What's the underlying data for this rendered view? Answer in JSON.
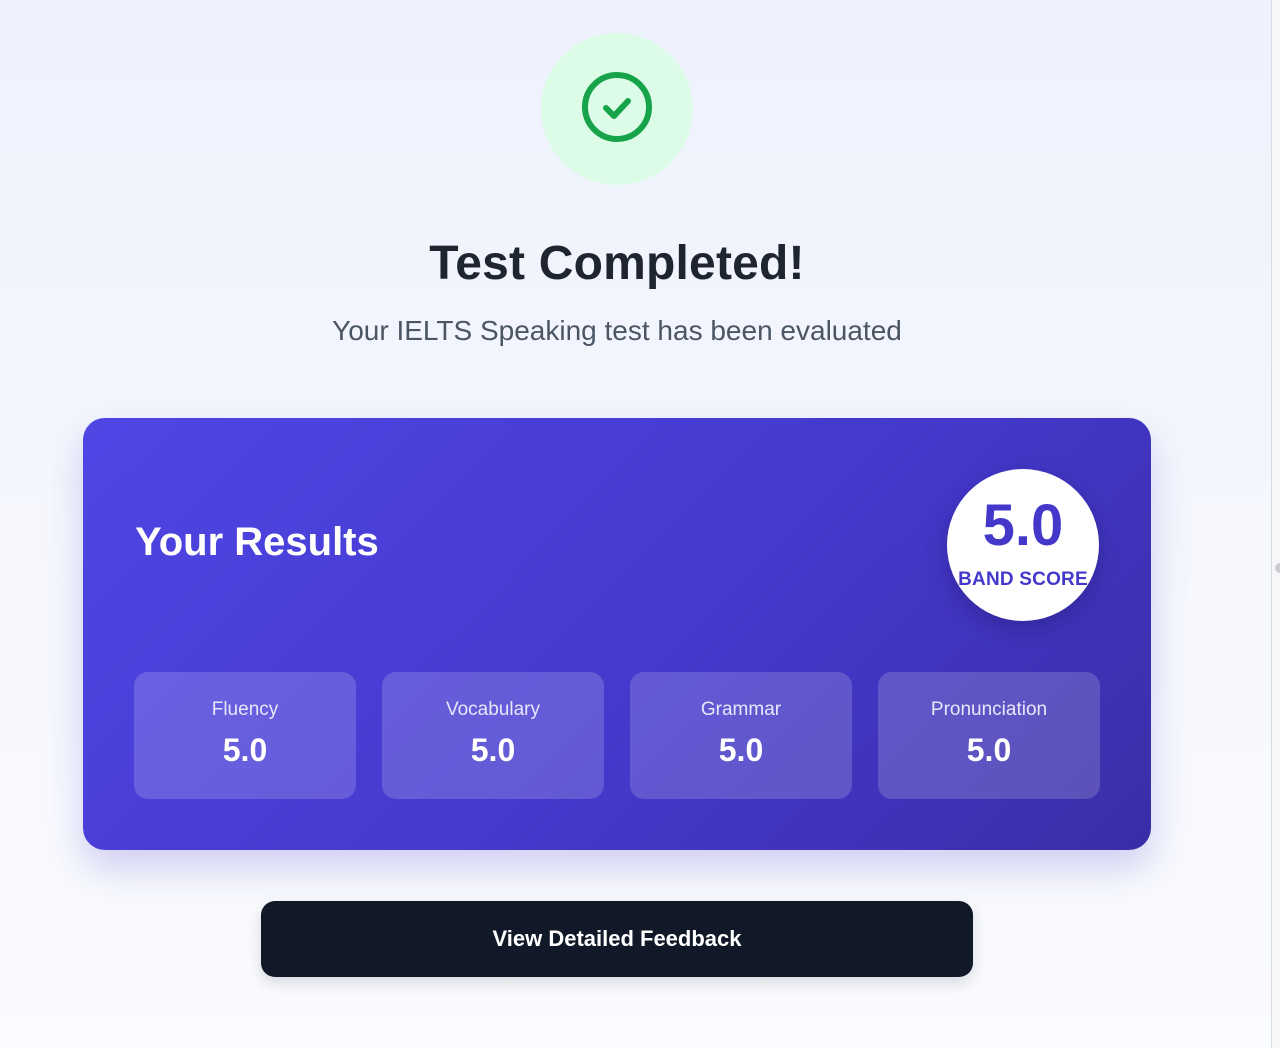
{
  "header": {
    "status_icon": "check-circle-icon",
    "title": "Test Completed!",
    "subtitle": "Your IELTS Speaking test has been evaluated"
  },
  "results": {
    "title": "Your Results",
    "band_score": {
      "value": "5.0",
      "label": "BAND SCORE"
    },
    "metrics": [
      {
        "label": "Fluency",
        "value": "5.0"
      },
      {
        "label": "Vocabulary",
        "value": "5.0"
      },
      {
        "label": "Grammar",
        "value": "5.0"
      },
      {
        "label": "Pronunciation",
        "value": "5.0"
      }
    ]
  },
  "actions": {
    "feedback_label": "View Detailed Feedback"
  },
  "colors": {
    "success": "#16a34a",
    "success_bg": "#dcfce7",
    "accent": "#4f46e5",
    "accent_dark": "#4338ca",
    "button_bg": "#111827",
    "title_text": "#1f2530",
    "subtitle_text": "#4b5563"
  }
}
